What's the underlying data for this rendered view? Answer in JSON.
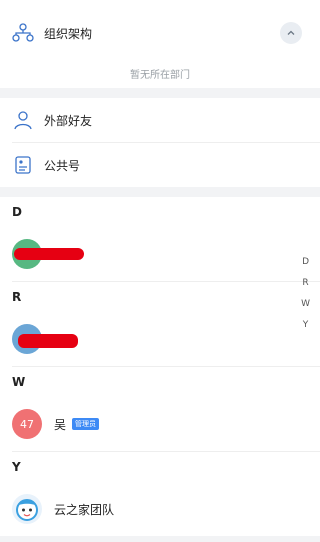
{
  "org": {
    "title": "组织架构",
    "empty_dept": "暂无所在部门",
    "icon": "org-structure-icon",
    "collapse_icon": "chevron-up-icon"
  },
  "menu": [
    {
      "label": "外部好友",
      "icon": "friend-icon"
    },
    {
      "label": "公共号",
      "icon": "public-account-icon"
    }
  ],
  "sections": [
    {
      "letter": "D",
      "contacts": [
        {
          "name": "",
          "avatar_color": "#57b882",
          "redacted": true
        }
      ]
    },
    {
      "letter": "R",
      "contacts": [
        {
          "name": "",
          "avatar_color": "#6ba6d6",
          "redacted": true
        }
      ]
    },
    {
      "letter": "W",
      "contacts": [
        {
          "name": "吴",
          "avatar_text": "47",
          "avatar_color": "#f07173",
          "badge": "管理员"
        }
      ]
    },
    {
      "letter": "Y",
      "contacts": [
        {
          "name": "云之家团队",
          "avatar_color": "#ffffff",
          "avatar_icon": "team-mascot-icon"
        }
      ]
    }
  ],
  "index": [
    "D",
    "R",
    "W",
    "Y"
  ],
  "colors": {
    "accent": "#3d8af5",
    "redaction": "#e60012"
  }
}
